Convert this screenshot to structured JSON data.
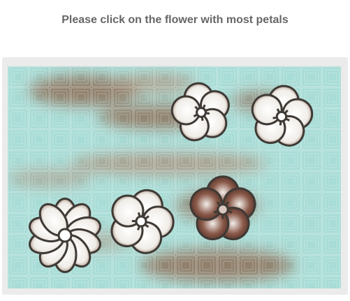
{
  "captcha": {
    "prompt": "Please click on the flower with most petals"
  },
  "colors": {
    "teal": "#a8dcd6",
    "teal_light": "#d4f0ec",
    "brown": "#8c6e58",
    "brown_dark": "#6b4a3a",
    "outline": "#3f3a36",
    "frame": "#ebebeb"
  },
  "flowers": [
    {
      "id": "flower-top-middle",
      "petals": 5,
      "shading": "light"
    },
    {
      "id": "flower-top-right",
      "petals": 5,
      "shading": "light"
    },
    {
      "id": "flower-bottom-left",
      "petals": 10,
      "shading": "light"
    },
    {
      "id": "flower-bottom-middle",
      "petals": 5,
      "shading": "light"
    },
    {
      "id": "flower-bottom-center-right",
      "petals": 5,
      "shading": "dark"
    }
  ]
}
